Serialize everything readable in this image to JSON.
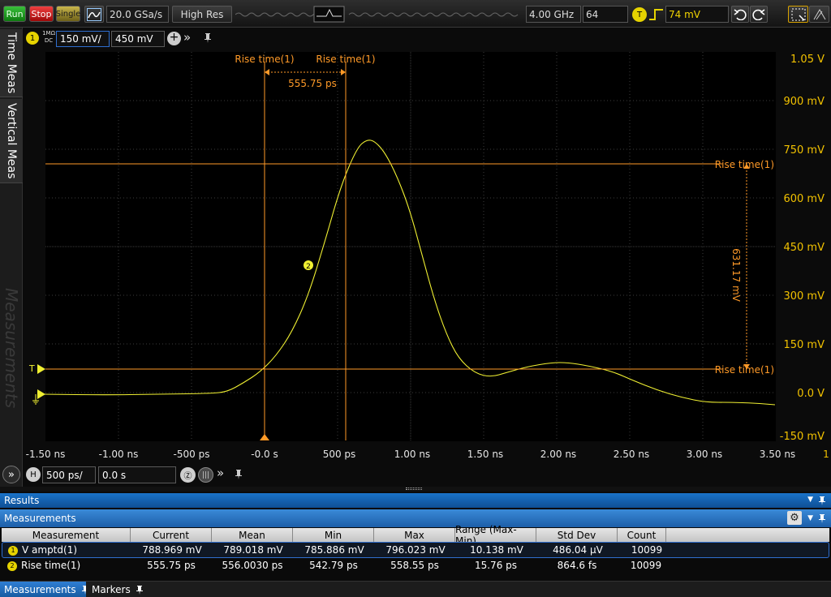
{
  "toolbar": {
    "run_label": "Run",
    "stop_label": "Stop",
    "single_label": "Single",
    "sample_rate": "20.0 GSa/s",
    "acq_mode": "High Res",
    "bandwidth": "4.00 GHz",
    "averages": "64",
    "trigger_badge": "T",
    "trigger_level": "74 mV"
  },
  "sidetabs": {
    "time_meas": "Time Meas",
    "vertical_meas": "Vertical Meas",
    "measurements": "Measurements"
  },
  "channel": {
    "number": "1",
    "coupling_top": "1MΩ",
    "coupling_bottom": "DC",
    "scale": "150 mV/",
    "offset": "450 mV"
  },
  "plot": {
    "y_ticks": [
      "1.05 V",
      "900 mV",
      "750 mV",
      "600 mV",
      "450 mV",
      "300 mV",
      "150 mV",
      "0.0 V",
      "-150 mV"
    ],
    "x_ticks": [
      "-1.50 ns",
      "-1.00 ns",
      "-500 ps",
      "-0.0 s",
      "500 ps",
      "1.00 ns",
      "1.50 ns",
      "2.00 ns",
      "2.50 ns",
      "3.00 ns",
      "3.50 ns"
    ],
    "x_tick_suffix": "1",
    "cursor_label_left": "Rise time(1)",
    "cursor_label_right": "Rise time(1)",
    "time_delta": "555.75 ps",
    "level_label_top": "Rise time(1)",
    "level_label_bottom": "Rise time(1)",
    "volt_delta": "631.17 mV",
    "marker_number": "2",
    "trigger_marker": "T"
  },
  "horizontal": {
    "badge": "H",
    "scale": "500 ps/",
    "position": "0.0 s"
  },
  "results": {
    "header": "Results",
    "measurements_header": "Measurements",
    "columns": [
      "Measurement",
      "Current",
      "Mean",
      "Min",
      "Max",
      "Range (Max-Min)",
      "Std Dev",
      "Count"
    ],
    "rows": [
      {
        "num": "1",
        "name": "V amptd(1)",
        "current": "788.969 mV",
        "mean": "789.018 mV",
        "min": "785.886 mV",
        "max": "796.023 mV",
        "range": "10.138 mV",
        "std": "486.04 µV",
        "count": "10099"
      },
      {
        "num": "2",
        "name": "Rise time(1)",
        "current": "555.75 ps",
        "mean": "556.0030 ps",
        "min": "542.79 ps",
        "max": "558.55 ps",
        "range": "15.76 ps",
        "std": "864.6 fs",
        "count": "10099"
      }
    ]
  },
  "bottomtabs": {
    "measurements": "Measurements",
    "markers": "Markers"
  },
  "colors": {
    "trace": "#f0f032",
    "cursor": "#ff9a28",
    "axis_label": "#f2c200",
    "grid": "#3c3c3c"
  }
}
